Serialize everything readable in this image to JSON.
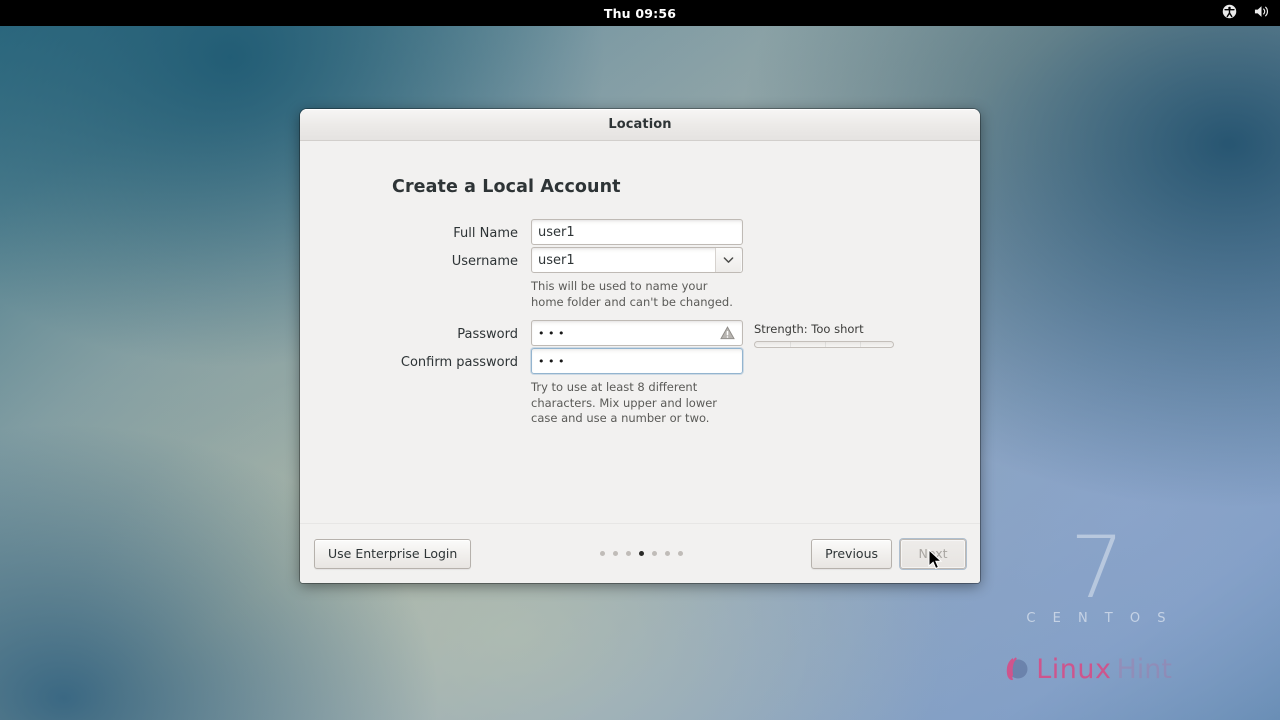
{
  "top_panel": {
    "clock": "Thu 09:56",
    "icons": [
      {
        "name": "accessibility-icon",
        "label": "Universal Access"
      },
      {
        "name": "volume-icon",
        "label": "Volume"
      }
    ]
  },
  "window": {
    "title": "Location"
  },
  "page": {
    "heading": "Create a Local Account",
    "fields": [
      {
        "id": "full-name",
        "label": "Full Name",
        "value": "user1",
        "placeholder": "",
        "type": "text"
      },
      {
        "id": "username",
        "label": "Username",
        "value": "user1",
        "placeholder": "",
        "type": "combo",
        "hint": "This will be used to name your home folder and can't be changed."
      },
      {
        "id": "password",
        "label": "Password",
        "value": "•••",
        "placeholder": "",
        "type": "password",
        "warning_icon": "warning-triangle-icon"
      },
      {
        "id": "confirm-password",
        "label": "Confirm password",
        "value": "•••",
        "placeholder": "",
        "type": "password",
        "focused": true,
        "hint": "Try to use at least 8 different characters. Mix upper and lower case and use a number or two."
      }
    ],
    "password_strength": {
      "label": "Strength: Too short",
      "value": 0
    }
  },
  "footer": {
    "enterprise_login_label": "Use Enterprise Login",
    "previous_label": "Previous",
    "next_label": "Next",
    "next_disabled": true,
    "page_dots": {
      "total": 7,
      "active_index": 3
    }
  },
  "desktop": {
    "brand_version": "7",
    "brand_name": "C E N T O S",
    "watermark_text": "Linux",
    "watermark_fade": "Hint",
    "accent_color": "#e0437f",
    "panel_color": "#000000"
  }
}
